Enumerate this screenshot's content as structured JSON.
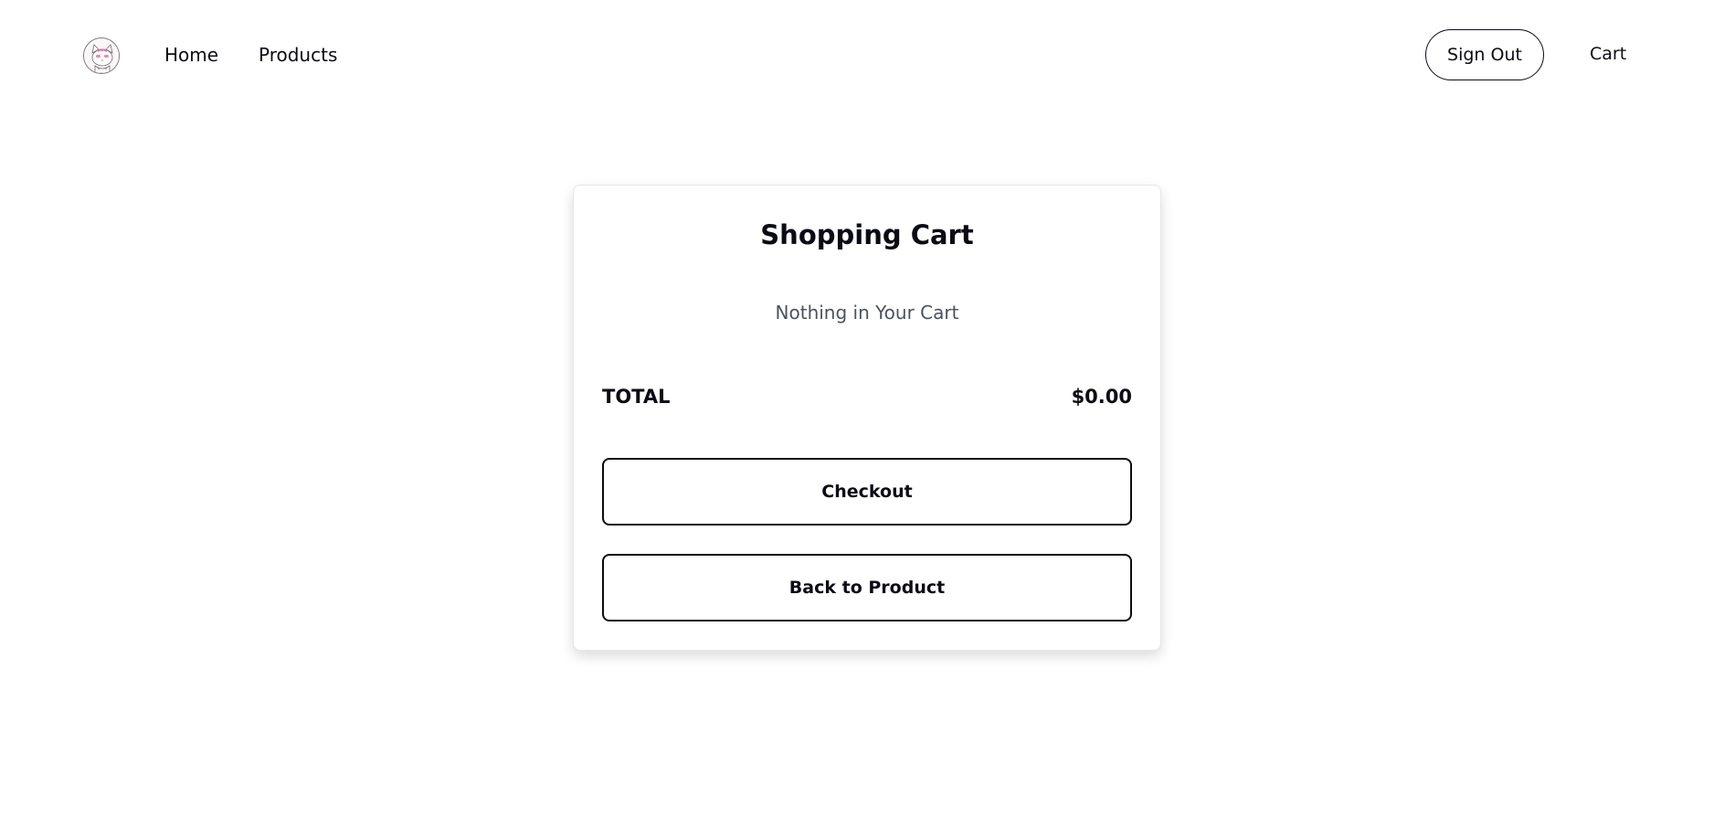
{
  "nav": {
    "logo_icon": "cat-avatar-icon",
    "home_label": "Home",
    "products_label": "Products",
    "signout_label": "Sign Out",
    "cart_label": "Cart"
  },
  "cart": {
    "title": "Shopping Cart",
    "empty_message": "Nothing in Your Cart",
    "total_label": "TOTAL",
    "total_value": "$0.00",
    "checkout_label": "Checkout",
    "back_label": "Back to Product"
  },
  "colors": {
    "text": "#0b0b16",
    "muted_text": "#4a5260",
    "background": "#ffffff",
    "logo_accent": "#e86aa8"
  }
}
